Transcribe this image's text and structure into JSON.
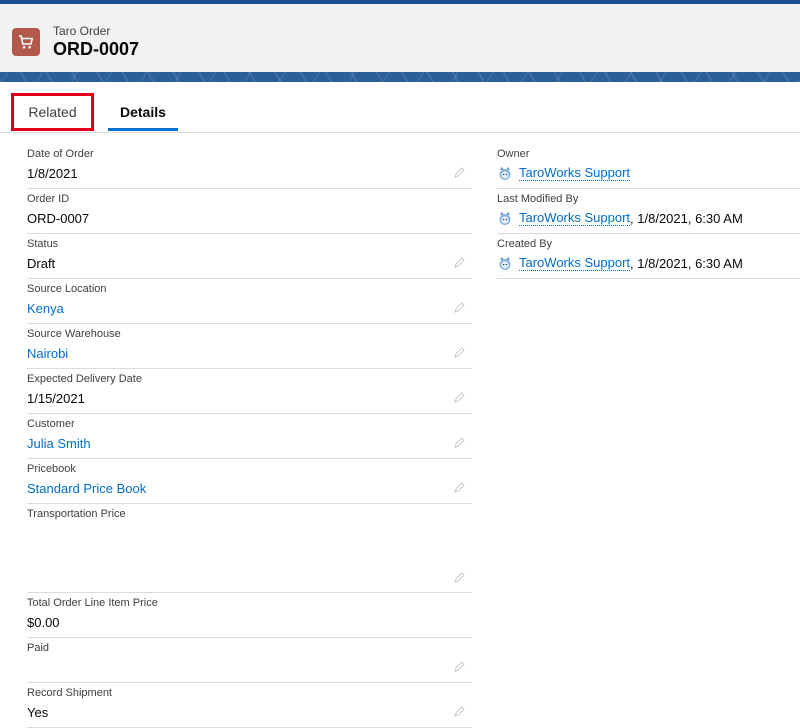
{
  "header": {
    "object_label": "Taro Order",
    "record_title": "ORD-0007",
    "icon": "cart-icon",
    "icon_color": "#b2594b"
  },
  "tabs": [
    {
      "label": "Related",
      "highlighted": true
    },
    {
      "label": "Details",
      "active": true
    }
  ],
  "left_fields": [
    {
      "label": "Date of Order",
      "value": "1/8/2021",
      "link": false,
      "editable": true
    },
    {
      "label": "Order ID",
      "value": "ORD-0007",
      "link": false,
      "editable": false
    },
    {
      "label": "Status",
      "value": "Draft",
      "link": false,
      "editable": true
    },
    {
      "label": "Source Location",
      "value": "Kenya",
      "link": true,
      "editable": true
    },
    {
      "label": "Source Warehouse",
      "value": "Nairobi",
      "link": true,
      "editable": true
    },
    {
      "label": "Expected Delivery Date",
      "value": "1/15/2021",
      "link": false,
      "editable": true
    },
    {
      "label": "Customer",
      "value": "Julia Smith",
      "link": true,
      "editable": true
    },
    {
      "label": "Pricebook",
      "value": "Standard Price Book",
      "link": true,
      "editable": true
    },
    {
      "label": "Transportation Price",
      "value": "",
      "link": false,
      "editable": true
    },
    {
      "label": "Total Order Line Item Price",
      "value": "$0.00",
      "link": false,
      "editable": false
    },
    {
      "label": "Paid",
      "value": "",
      "link": false,
      "editable": true
    },
    {
      "label": "Record Shipment",
      "value": "Yes",
      "link": false,
      "editable": true
    }
  ],
  "right_fields": [
    {
      "label": "Owner",
      "user": "TaroWorks Support",
      "extra": ""
    },
    {
      "label": "Last Modified By",
      "user": "TaroWorks Support",
      "extra": ", 1/8/2021, 6:30 AM"
    },
    {
      "label": "Created By",
      "user": "TaroWorks Support",
      "extra": ", 1/8/2021, 6:30 AM"
    }
  ],
  "colors": {
    "link": "#006dcc",
    "active_tab": "#0070d2",
    "highlight": "#e0001b"
  }
}
